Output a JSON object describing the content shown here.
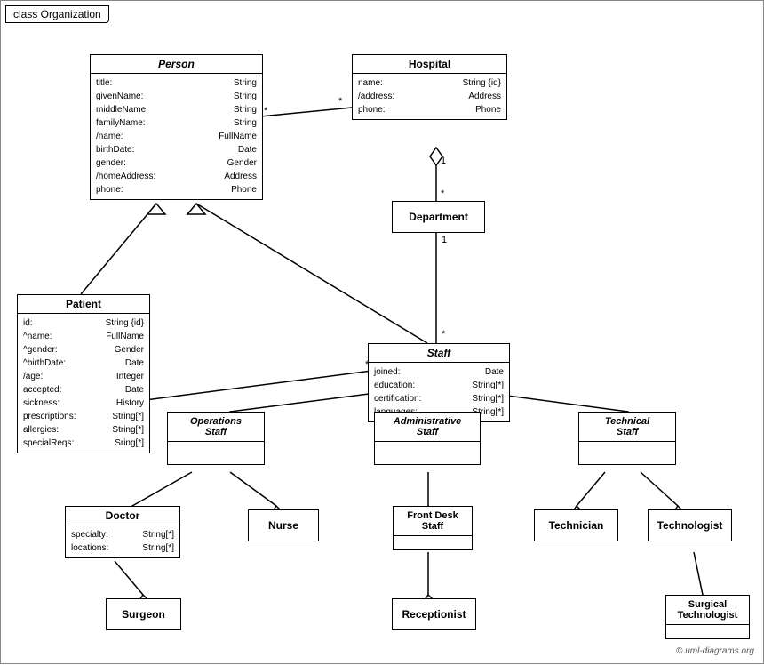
{
  "title": "class Organization",
  "copyright": "© uml-diagrams.org",
  "boxes": {
    "person": {
      "title": "Person",
      "italic": true,
      "attrs": [
        [
          "title:",
          "String"
        ],
        [
          "givenName:",
          "String"
        ],
        [
          "middleName:",
          "String"
        ],
        [
          "familyName:",
          "String"
        ],
        [
          "/name:",
          "FullName"
        ],
        [
          "birthDate:",
          "Date"
        ],
        [
          "gender:",
          "Gender"
        ],
        [
          "/homeAddress:",
          "Address"
        ],
        [
          "phone:",
          "Phone"
        ]
      ]
    },
    "hospital": {
      "title": "Hospital",
      "italic": false,
      "attrs": [
        [
          "name:",
          "String {id}"
        ],
        [
          "/address:",
          "Address"
        ],
        [
          "phone:",
          "Phone"
        ]
      ]
    },
    "patient": {
      "title": "Patient",
      "italic": false,
      "attrs": [
        [
          "id:",
          "String {id}"
        ],
        [
          "^name:",
          "FullName"
        ],
        [
          "^gender:",
          "Gender"
        ],
        [
          "^birthDate:",
          "Date"
        ],
        [
          "/age:",
          "Integer"
        ],
        [
          "accepted:",
          "Date"
        ],
        [
          "sickness:",
          "History"
        ],
        [
          "prescriptions:",
          "String[*]"
        ],
        [
          "allergies:",
          "String[*]"
        ],
        [
          "specialReqs:",
          "Sring[*]"
        ]
      ]
    },
    "department": {
      "title": "Department",
      "italic": false
    },
    "staff": {
      "title": "Staff",
      "italic": true,
      "attrs": [
        [
          "joined:",
          "Date"
        ],
        [
          "education:",
          "String[*]"
        ],
        [
          "certification:",
          "String[*]"
        ],
        [
          "languages:",
          "String[*]"
        ]
      ]
    },
    "operations_staff": {
      "title": "Operations\nStaff",
      "italic": true
    },
    "administrative_staff": {
      "title": "Administrative\nStaff",
      "italic": true
    },
    "technical_staff": {
      "title": "Technical\nStaff",
      "italic": true
    },
    "doctor": {
      "title": "Doctor",
      "italic": false,
      "attrs": [
        [
          "specialty:",
          "String[*]"
        ],
        [
          "locations:",
          "String[*]"
        ]
      ]
    },
    "nurse": {
      "title": "Nurse",
      "italic": false
    },
    "front_desk_staff": {
      "title": "Front Desk\nStaff",
      "italic": false
    },
    "technician": {
      "title": "Technician",
      "italic": false
    },
    "technologist": {
      "title": "Technologist",
      "italic": false
    },
    "surgeon": {
      "title": "Surgeon",
      "italic": false
    },
    "receptionist": {
      "title": "Receptionist",
      "italic": false
    },
    "surgical_technologist": {
      "title": "Surgical\nTechnologist",
      "italic": false
    }
  }
}
